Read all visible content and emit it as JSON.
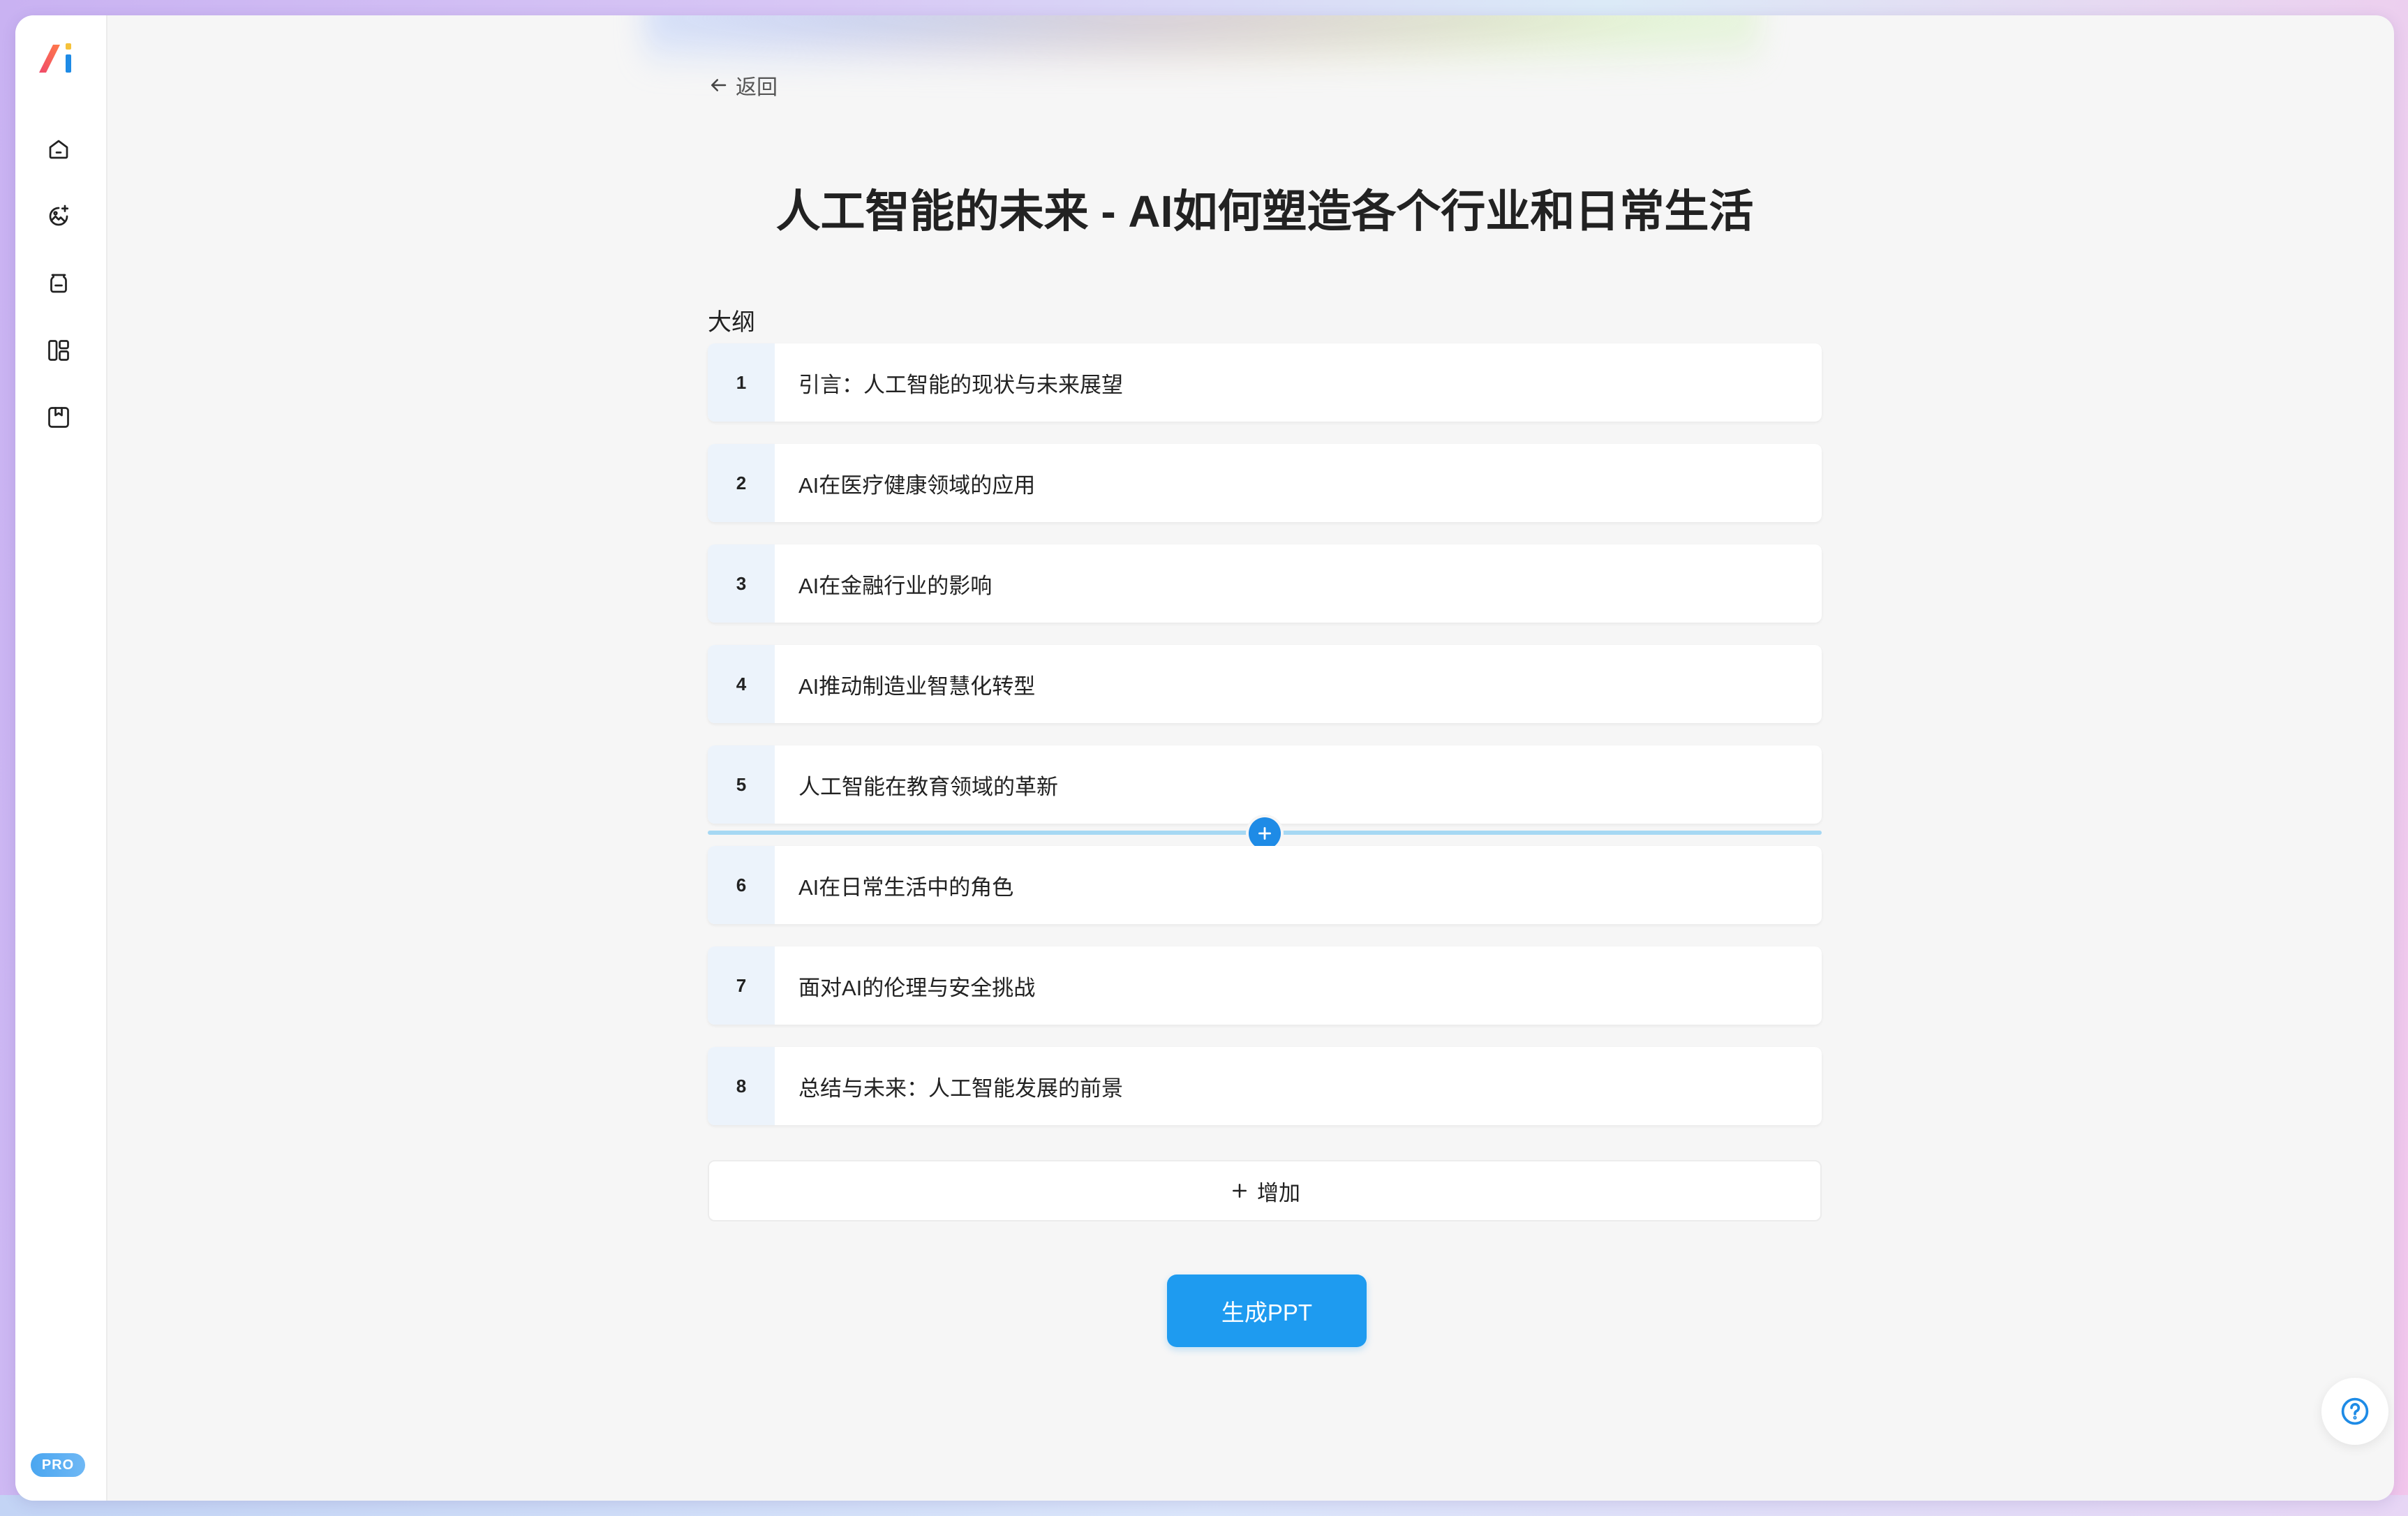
{
  "nav": {
    "back_label": "返回",
    "icons": [
      "home-icon",
      "image-sparkle-icon",
      "jar-icon",
      "layout-icon",
      "bookmark-box-icon"
    ],
    "pro_badge": "PRO"
  },
  "page": {
    "title": "人工智能的未来 - AI如何塑造各个行业和日常生活",
    "outline_label": "大纲"
  },
  "outline": [
    {
      "num": "1",
      "text": "引言：人工智能的现状与未来展望"
    },
    {
      "num": "2",
      "text": "AI在医疗健康领域的应用"
    },
    {
      "num": "3",
      "text": "AI在金融行业的影响"
    },
    {
      "num": "4",
      "text": "AI推动制造业智慧化转型"
    },
    {
      "num": "5",
      "text": "人工智能在教育领域的革新"
    },
    {
      "num": "6",
      "text": "AI在日常生活中的角色"
    },
    {
      "num": "7",
      "text": "面对AI的伦理与安全挑战"
    },
    {
      "num": "8",
      "text": "总结与未来：人工智能发展的前景"
    }
  ],
  "actions": {
    "add_label": "增加",
    "generate_label": "生成PPT"
  },
  "colors": {
    "accent": "#1e9bf0",
    "number_bg": "#ecf3fb",
    "insert_line": "#a6d8f3"
  }
}
